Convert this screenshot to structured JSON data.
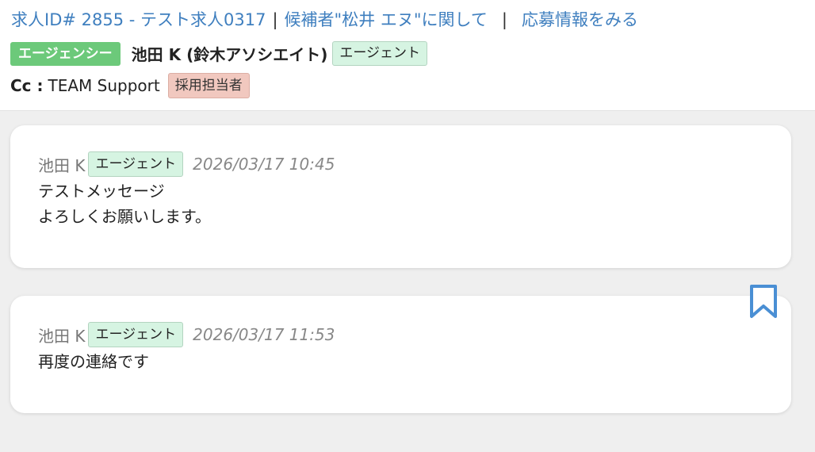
{
  "header": {
    "breadcrumb": {
      "job_link": "求人ID# 2855 - テスト求人0317",
      "separator": "|",
      "candidate_link": "候補者\"松井 エヌ\"に関して",
      "application_link": "応募情報をみる"
    },
    "agency_badge": "エージェンシー",
    "sender_name": "池田 K (鈴木アソシエイト)",
    "agent_badge": "エージェント",
    "cc_label": "Cc :",
    "cc_value": "TEAM Support",
    "cc_role_badge": "採用担当者"
  },
  "messages": [
    {
      "sender": "池田 K",
      "role": "エージェント",
      "timestamp": "2026/03/17 10:45",
      "body": "テストメッセージ\nよろしくお願いします。"
    },
    {
      "sender": "池田 K",
      "role": "エージェント",
      "timestamp": "2026/03/17 11:53",
      "body": "再度の連絡です"
    }
  ],
  "icons": {
    "bookmark": "bookmark-icon"
  },
  "colors": {
    "link": "#3f7fbf",
    "agency_badge": "#6cc97a",
    "agent_badge": "#d6f4e2",
    "hr_badge": "#f1c8bf",
    "bookmark": "#4a8fd4"
  }
}
